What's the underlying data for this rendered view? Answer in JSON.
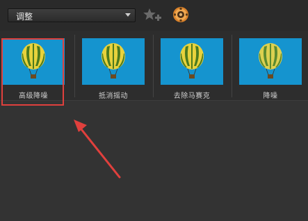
{
  "toolbar": {
    "dropdown_value": "调整",
    "icons": [
      "add-favorite-icon",
      "camera-effects-icon"
    ]
  },
  "effects": [
    {
      "label": "高级降噪",
      "selected": true
    },
    {
      "label": "抵消摇动",
      "selected": false
    },
    {
      "label": "去除马赛克",
      "selected": false
    },
    {
      "label": "降噪",
      "selected": false
    }
  ],
  "colors": {
    "thumb_sky": "#1aa0d8",
    "balloon_yellow": "#e8d23c",
    "balloon_green": "#4c7a1e",
    "highlight": "#e0403d",
    "background": "#333333"
  }
}
